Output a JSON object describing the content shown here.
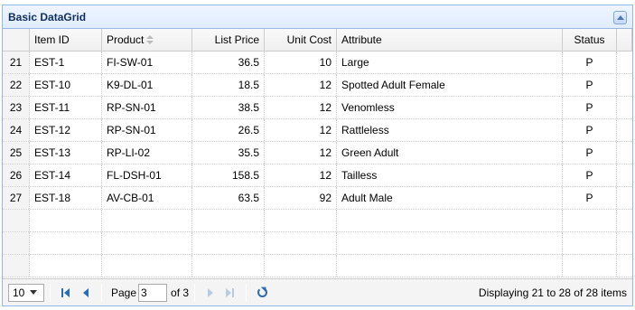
{
  "panel": {
    "title": "Basic DataGrid"
  },
  "columns": {
    "item_id": "Item ID",
    "product": "Product",
    "list_price": "List Price",
    "unit_cost": "Unit Cost",
    "attribute": "Attribute",
    "status": "Status"
  },
  "rows": [
    {
      "rn": "21",
      "item_id": "EST-1",
      "product": "FI-SW-01",
      "list_price": "36.5",
      "unit_cost": "10",
      "attribute": "Large",
      "status": "P"
    },
    {
      "rn": "22",
      "item_id": "EST-10",
      "product": "K9-DL-01",
      "list_price": "18.5",
      "unit_cost": "12",
      "attribute": "Spotted Adult Female",
      "status": "P"
    },
    {
      "rn": "23",
      "item_id": "EST-11",
      "product": "RP-SN-01",
      "list_price": "38.5",
      "unit_cost": "12",
      "attribute": "Venomless",
      "status": "P"
    },
    {
      "rn": "24",
      "item_id": "EST-12",
      "product": "RP-SN-01",
      "list_price": "26.5",
      "unit_cost": "12",
      "attribute": "Rattleless",
      "status": "P"
    },
    {
      "rn": "25",
      "item_id": "EST-13",
      "product": "RP-LI-02",
      "list_price": "35.5",
      "unit_cost": "12",
      "attribute": "Green Adult",
      "status": "P"
    },
    {
      "rn": "26",
      "item_id": "EST-14",
      "product": "FL-DSH-01",
      "list_price": "158.5",
      "unit_cost": "12",
      "attribute": "Tailless",
      "status": "P"
    },
    {
      "rn": "27",
      "item_id": "EST-18",
      "product": "AV-CB-01",
      "list_price": "63.5",
      "unit_cost": "92",
      "attribute": "Adult Male",
      "status": "P"
    }
  ],
  "pager": {
    "page_size": "10",
    "page_label": "Page",
    "current_page": "3",
    "of_pages": "of 3",
    "info": "Displaying 21 to 28 of 28 items"
  },
  "icons": {
    "sort": "sort-icon",
    "collapse": "collapse-icon",
    "first": "first-page-icon",
    "prev": "prev-page-icon",
    "next": "next-page-icon",
    "last": "last-page-icon",
    "refresh": "refresh-icon"
  },
  "colors": {
    "panel_border": "#95b8e7",
    "header_bg": "#e0ecff",
    "icon_blue": "#2a6bb8"
  }
}
